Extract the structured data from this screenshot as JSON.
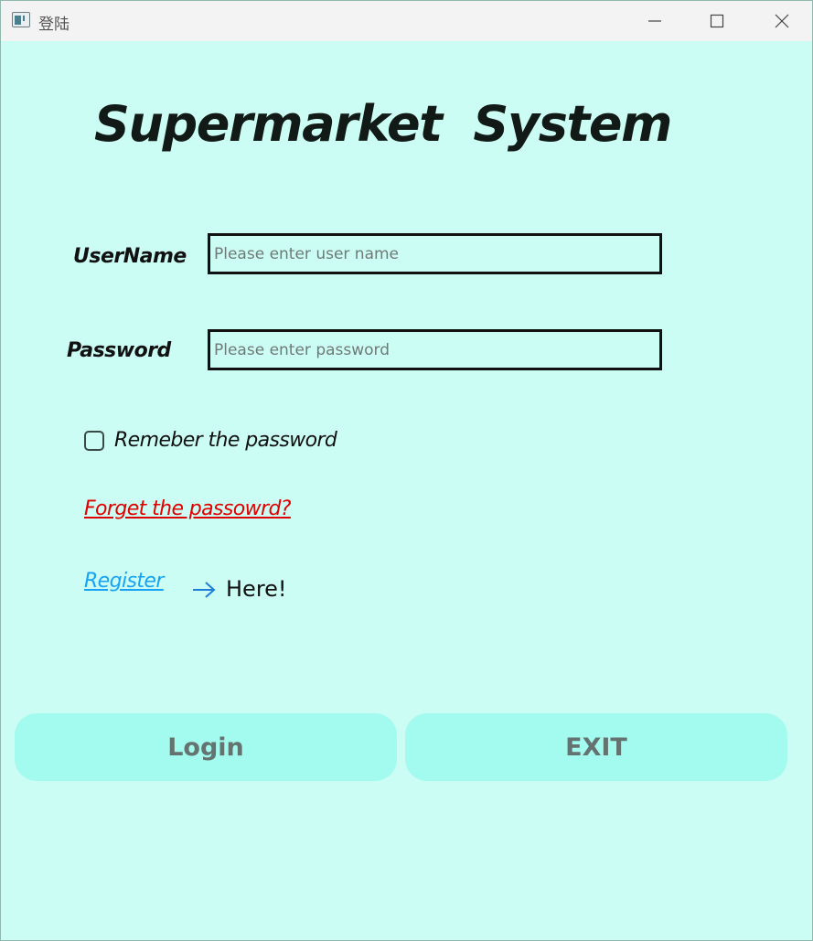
{
  "window": {
    "title": "登陆"
  },
  "app_title": "Supermarket  System",
  "form": {
    "username_label": "UserName",
    "username_placeholder": "Please enter user name",
    "username_value": "",
    "password_label": "Password",
    "password_placeholder": "Please enter password",
    "password_value": "",
    "remember_label": "Remeber the password",
    "remember_checked": false,
    "forgot_link": "Forget the passowrd?",
    "register_link": "Register",
    "here_text": "Here!"
  },
  "buttons": {
    "login": "Login",
    "exit": "EXIT"
  },
  "icons": {
    "app": "window-app-icon",
    "minimize": "minimize-icon",
    "maximize": "maximize-icon",
    "close": "close-icon",
    "arrow": "arrow-right-icon"
  },
  "colors": {
    "background": "#ccfdf4",
    "button": "#a3faef",
    "forgot_link": "#e00000",
    "register_link": "#17a3f5",
    "arrow": "#1f7fd8"
  }
}
